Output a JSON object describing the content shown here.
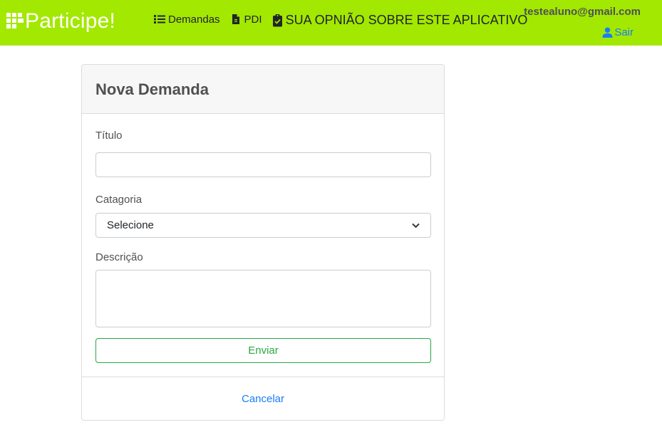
{
  "header": {
    "brand": "Participe!",
    "nav": {
      "demandas": "Demandas",
      "pdi": "PDI",
      "opiniao": "SUA OPNIÃO SOBRE ESTE APLICATIVO"
    },
    "user_email": "testealuno@gmail.com",
    "logout_label": "Sair"
  },
  "form": {
    "title": "Nova Demanda",
    "titulo_label": "Título",
    "titulo_value": "",
    "categoria_label": "Catagoria",
    "categoria_selected": "Selecione",
    "descricao_label": "Descrição",
    "descricao_value": "",
    "submit_label": "Enviar",
    "cancel_label": "Cancelar"
  },
  "icons": {
    "brand": "grid-logo-icon",
    "demandas": "list-icon",
    "pdi": "file-icon",
    "opiniao": "clipboard-check-icon",
    "logout": "user-icon",
    "select": "chevron-down-icon"
  },
  "colors": {
    "header_bg": "#a3e800",
    "link": "#1a7df7",
    "success": "#28a745"
  }
}
